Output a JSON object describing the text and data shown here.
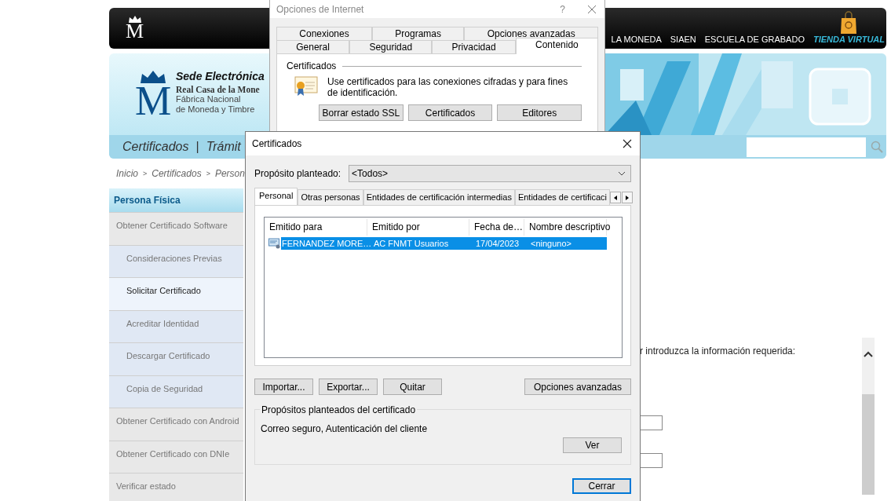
{
  "site": {
    "logo_letter": "M",
    "top_nav": [
      {
        "label": "LA MONEDA",
        "kind": "link"
      },
      {
        "label": "SIAEN",
        "kind": "link"
      },
      {
        "label": "ESCUELA DE GRABADO",
        "kind": "link"
      },
      {
        "label": "TIENDA VIRTUAL",
        "kind": "store"
      }
    ],
    "banner": {
      "logo_letter": "M",
      "title": "Sede Electrónica",
      "org_name": "Real Casa de la Mone",
      "org_line_1": "Fábrica Nacional",
      "org_line_2": "de Moneda y Timbre"
    },
    "menu": {
      "items": [
        "Certificados",
        "Trámit"
      ],
      "separator": "|"
    },
    "breadcrumb": {
      "items": [
        "Inicio",
        "Certificados",
        "Person"
      ],
      "separator": ">"
    },
    "sidebar": {
      "heading": "Persona Física",
      "items": [
        {
          "label": "Obtener Certificado Software",
          "selected": false,
          "children": [
            {
              "label": "Consideraciones Previas",
              "selected": false
            },
            {
              "label": "Solicitar Certificado",
              "selected": true
            },
            {
              "label": "Acreditar Identidad",
              "selected": false
            },
            {
              "label": "Descargar Certificado",
              "selected": false
            },
            {
              "label": "Copia de Seguridad",
              "selected": false
            }
          ]
        },
        {
          "label": "Obtener Certificado con Android",
          "selected": false
        },
        {
          "label": "Obtener Certificado con DNIe",
          "selected": false
        },
        {
          "label": "Verificar estado",
          "selected": false
        }
      ]
    },
    "content": {
      "instruction": "r introduzca la información requerida:"
    }
  },
  "internet_options": {
    "title": "Opciones de Internet",
    "help": "?",
    "tab_rows": [
      [
        {
          "label": "Conexiones",
          "selected": false
        },
        {
          "label": "Programas",
          "selected": false
        },
        {
          "label": "Opciones avanzadas",
          "selected": false
        }
      ],
      [
        {
          "label": "General",
          "selected": false
        },
        {
          "label": "Seguridad",
          "selected": false
        },
        {
          "label": "Privacidad",
          "selected": false
        },
        {
          "label": "Contenido",
          "selected": true
        }
      ]
    ],
    "group_label": "Certificados",
    "description": "Use certificados para las conexiones cifradas y para fines de identificación.",
    "buttons": [
      "Borrar estado SSL",
      "Certificados",
      "Editores"
    ]
  },
  "certificates": {
    "title": "Certificados",
    "purpose_label": "Propósito planteado:",
    "purpose_value": "<Todos>",
    "tabs": [
      {
        "label": "Personal",
        "selected": true
      },
      {
        "label": "Otras personas",
        "selected": false
      },
      {
        "label": "Entidades de certificación intermedias",
        "selected": false
      },
      {
        "label": "Entidades de certificaci",
        "selected": false
      }
    ],
    "columns": [
      "Emitido para",
      "Emitido por",
      "Fecha de…",
      "Nombre descriptivo"
    ],
    "rows": [
      {
        "cells": [
          "FERNANDEZ MORE…",
          "AC FNMT Usuarios",
          "17/04/2023",
          "<ninguno>"
        ],
        "selected": true
      }
    ],
    "buttons": [
      "Importar...",
      "Exportar...",
      "Quitar"
    ],
    "advanced_button": "Opciones avanzadas",
    "purposes": {
      "label": "Propósitos planteados del certificado",
      "text": "Correo seguro, Autenticación del cliente",
      "button": "Ver"
    },
    "close_button": "Cerrar"
  }
}
